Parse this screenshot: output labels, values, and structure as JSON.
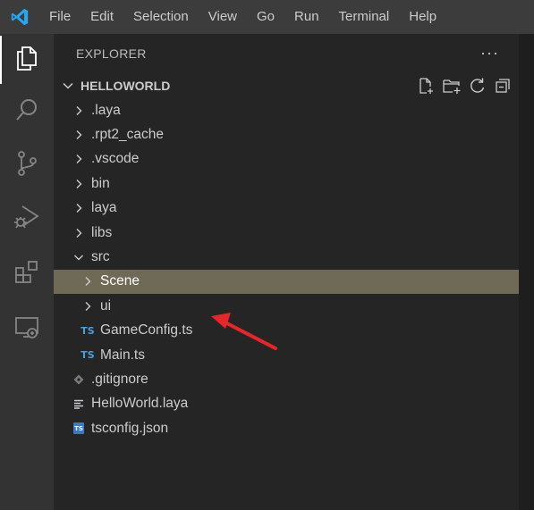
{
  "menu": {
    "items": [
      "File",
      "Edit",
      "Selection",
      "View",
      "Go",
      "Run",
      "Terminal",
      "Help"
    ]
  },
  "activity_bar": {
    "items": [
      {
        "name": "explorer",
        "icon": "files-icon",
        "active": true
      },
      {
        "name": "search",
        "icon": "search-icon",
        "active": false
      },
      {
        "name": "source-control",
        "icon": "source-control-icon",
        "active": false
      },
      {
        "name": "run-and-debug",
        "icon": "run-debug-icon",
        "active": false
      },
      {
        "name": "extensions",
        "icon": "extensions-icon",
        "active": false
      },
      {
        "name": "remote-explorer",
        "icon": "remote-explorer-icon",
        "active": false
      }
    ]
  },
  "sidebar": {
    "title": "EXPLORER",
    "more": "···",
    "section": {
      "title": "HELLOWORLD",
      "actions": [
        "new-file-icon",
        "new-folder-icon",
        "refresh-icon",
        "collapse-all-icon"
      ]
    },
    "tree": [
      {
        "label": ".laya",
        "type": "folder",
        "expanded": false,
        "depth": 0
      },
      {
        "label": ".rpt2_cache",
        "type": "folder",
        "expanded": false,
        "depth": 0
      },
      {
        "label": ".vscode",
        "type": "folder",
        "expanded": false,
        "depth": 0
      },
      {
        "label": "bin",
        "type": "folder",
        "expanded": false,
        "depth": 0
      },
      {
        "label": "laya",
        "type": "folder",
        "expanded": false,
        "depth": 0
      },
      {
        "label": "libs",
        "type": "folder",
        "expanded": false,
        "depth": 0
      },
      {
        "label": "src",
        "type": "folder",
        "expanded": true,
        "depth": 0
      },
      {
        "label": "Scene",
        "type": "folder",
        "expanded": false,
        "depth": 1,
        "selected": true
      },
      {
        "label": "ui",
        "type": "folder",
        "expanded": false,
        "depth": 1
      },
      {
        "label": "GameConfig.ts",
        "type": "ts",
        "depth": 1
      },
      {
        "label": "Main.ts",
        "type": "ts",
        "depth": 1
      },
      {
        "label": ".gitignore",
        "type": "git",
        "depth": 0
      },
      {
        "label": "HelloWorld.laya",
        "type": "text",
        "depth": 0
      },
      {
        "label": "tsconfig.json",
        "type": "json",
        "depth": 0
      }
    ]
  },
  "badges": {
    "ts": "TS",
    "json": "TS"
  },
  "colors": {
    "accent": "#0078d4",
    "selected_row": "#6f6a56",
    "annotation_arrow": "#e8262a"
  }
}
